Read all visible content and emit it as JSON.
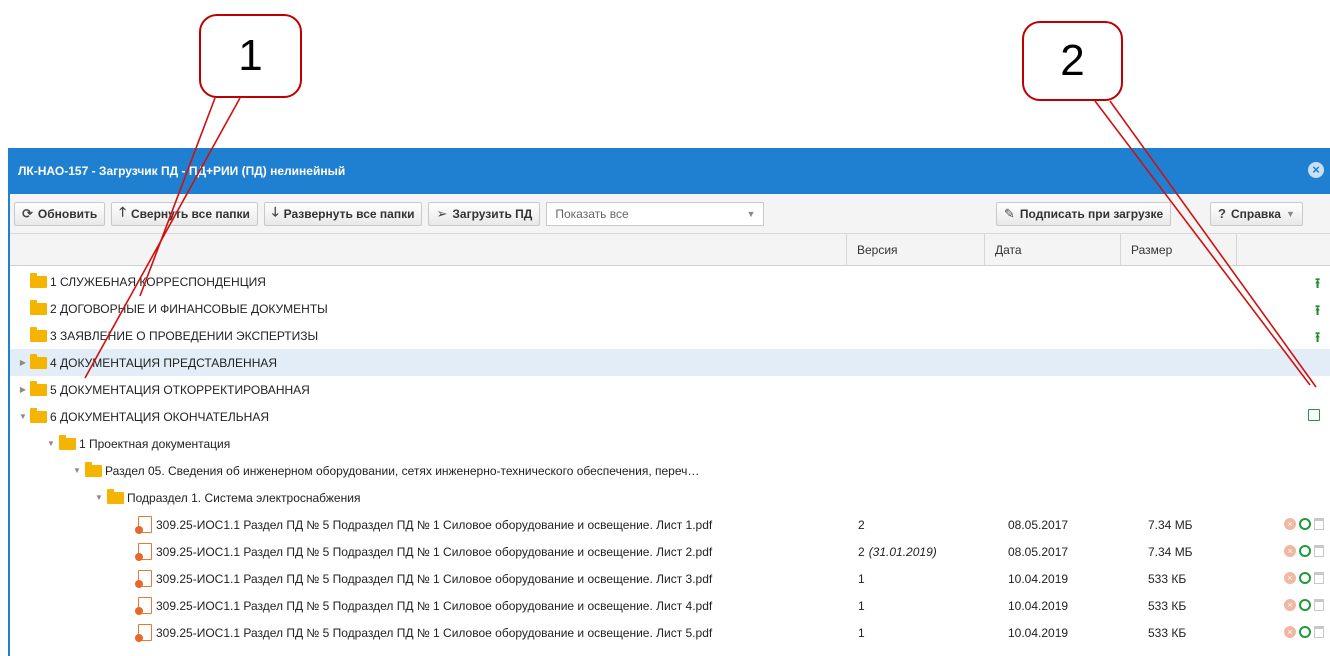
{
  "callouts": [
    "1",
    "2"
  ],
  "window": {
    "title": "ЛК-НАО-157 - Загрузчик ПД - ПД+РИИ (ПД) нелинейный",
    "close_icon": "close-icon"
  },
  "toolbar": {
    "refresh": "Обновить",
    "collapse_all": "Свернуть все папки",
    "expand_all": "Развернуть все папки",
    "upload_pd": "Загрузить ПД",
    "filter_value": "Показать все",
    "sign_on_upload": "Подписать при загрузке",
    "help": "Справка"
  },
  "columns": [
    "Версия",
    "Дата",
    "Размер"
  ],
  "folders": [
    {
      "label": "1 СЛУЖЕБНАЯ КОРРЕСПОНДЕНЦИЯ"
    },
    {
      "label": "2 ДОГОВОРНЫЕ И ФИНАНСОВЫЕ ДОКУМЕНТЫ"
    },
    {
      "label": "3 ЗАЯВЛЕНИЕ О ПРОВЕДЕНИИ ЭКСПЕРТИЗЫ"
    },
    {
      "label": "4 ДОКУМЕНТАЦИЯ ПРЕДСТАВЛЕННАЯ"
    },
    {
      "label": "5 ДОКУМЕНТАЦИЯ ОТКОРРЕКТИРОВАННАЯ"
    },
    {
      "label": "6 ДОКУМЕНТАЦИЯ ОКОНЧАТЕЛЬНАЯ"
    }
  ],
  "subfolders": {
    "level1": "1 Проектная документация",
    "level2": "Раздел 05. Сведения об инженерном оборудовании, сетях инженерно-технического обеспечения, переч…",
    "level3": "Подраздел 1. Система электроснабжения"
  },
  "files": [
    {
      "name": "309.25-ИОС1.1 Раздел ПД № 5 Подраздел ПД № 1 Силовое оборудование и освещение. Лист 1.pdf",
      "version": "2",
      "version_note": "",
      "date": "08.05.2017",
      "size": "7.34 МБ"
    },
    {
      "name": "309.25-ИОС1.1 Раздел ПД № 5 Подраздел ПД № 1 Силовое оборудование и освещение. Лист 2.pdf",
      "version": "2",
      "version_note": "(31.01.2019)",
      "date": "08.05.2017",
      "size": "7.34 МБ"
    },
    {
      "name": "309.25-ИОС1.1 Раздел ПД № 5 Подраздел ПД № 1 Силовое оборудование и освещение. Лист 3.pdf",
      "version": "1",
      "version_note": "",
      "date": "10.04.2019",
      "size": "533 КБ"
    },
    {
      "name": "309.25-ИОС1.1 Раздел ПД № 5 Подраздел ПД № 1 Силовое оборудование и освещение. Лист 4.pdf",
      "version": "1",
      "version_note": "",
      "date": "10.04.2019",
      "size": "533 КБ"
    },
    {
      "name": "309.25-ИОС1.1 Раздел ПД № 5 Подраздел ПД № 1 Силовое оборудование и освещение. Лист 5.pdf",
      "version": "1",
      "version_note": "",
      "date": "10.04.2019",
      "size": "533 КБ"
    }
  ],
  "colors": {
    "titlebar": "#1f7fd0",
    "callout_border": "#c00000",
    "folder": "#f5b400",
    "upload": "#1f8a2e"
  }
}
